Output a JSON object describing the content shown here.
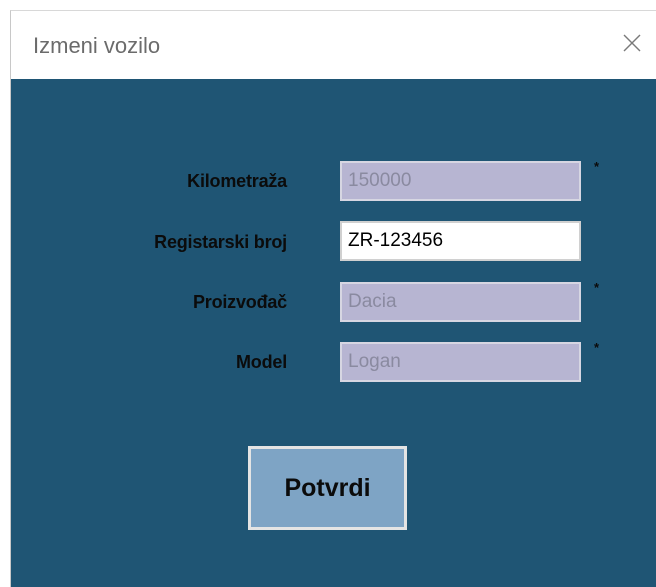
{
  "window": {
    "title": "Izmeni vozilo"
  },
  "form": {
    "fields": [
      {
        "label": "Kilometraža",
        "value": "150000",
        "enabled": false,
        "required": true
      },
      {
        "label": "Registarski broj",
        "value": "ZR-123456",
        "enabled": true,
        "required": false
      },
      {
        "label": "Proizvođač",
        "value": "Dacia",
        "enabled": false,
        "required": true
      },
      {
        "label": "Model",
        "value": "Logan",
        "enabled": false,
        "required": true
      }
    ],
    "required_marker": "*",
    "submit_label": "Potvrdi"
  },
  "icons": {
    "close": "close-icon"
  },
  "colors": {
    "background": "#1f5574",
    "disabled_field": "#b7b5d2",
    "button": "#7ea4c5"
  }
}
